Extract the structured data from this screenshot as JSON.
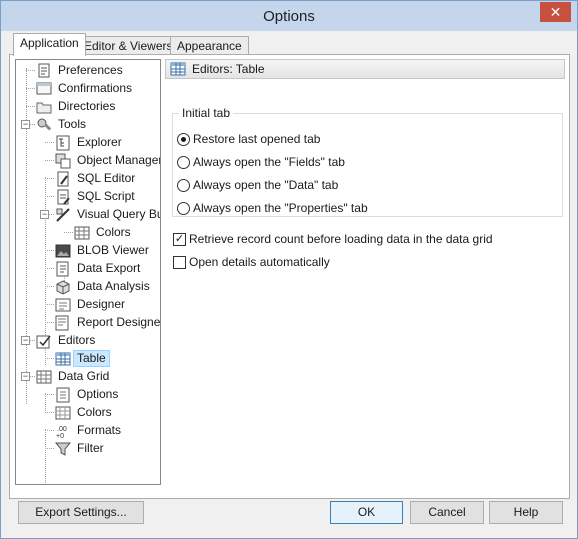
{
  "window": {
    "title": "Options",
    "close_glyph": "✕"
  },
  "tabs": [
    {
      "label": "Application",
      "active": true
    },
    {
      "label": "Editor & Viewers",
      "active": false
    },
    {
      "label": "Appearance",
      "active": false
    }
  ],
  "tree": {
    "items": [
      {
        "label": "Preferences",
        "icon": "preferences-icon",
        "level": 1
      },
      {
        "label": "Confirmations",
        "icon": "confirmations-icon",
        "level": 1
      },
      {
        "label": "Directories",
        "icon": "folder-icon",
        "level": 1
      },
      {
        "label": "Tools",
        "icon": "tools-icon",
        "level": 1,
        "expanded": true
      },
      {
        "label": "Explorer",
        "icon": "explorer-icon",
        "level": 2
      },
      {
        "label": "Object Manager",
        "icon": "object-manager-icon",
        "level": 2
      },
      {
        "label": "SQL Editor",
        "icon": "sql-editor-icon",
        "level": 2
      },
      {
        "label": "SQL Script",
        "icon": "sql-script-icon",
        "level": 2
      },
      {
        "label": "Visual Query Builder",
        "icon": "visual-query-icon",
        "level": 2,
        "expanded": true
      },
      {
        "label": "Colors",
        "icon": "grid-icon",
        "level": 3
      },
      {
        "label": "BLOB Viewer",
        "icon": "blob-viewer-icon",
        "level": 2
      },
      {
        "label": "Data Export",
        "icon": "data-export-icon",
        "level": 2
      },
      {
        "label": "Data Analysis",
        "icon": "data-analysis-icon",
        "level": 2
      },
      {
        "label": "Designer",
        "icon": "designer-icon",
        "level": 2
      },
      {
        "label": "Report Designer",
        "icon": "report-designer-icon",
        "level": 2
      },
      {
        "label": "Editors",
        "icon": "editors-icon",
        "level": 1,
        "expanded": true
      },
      {
        "label": "Table",
        "icon": "table-icon",
        "level": 2,
        "selected": true
      },
      {
        "label": "Data Grid",
        "icon": "grid-icon",
        "level": 1,
        "expanded": true
      },
      {
        "label": "Options",
        "icon": "options-icon",
        "level": 2
      },
      {
        "label": "Colors",
        "icon": "colors-icon",
        "level": 2
      },
      {
        "label": "Formats",
        "icon": "formats-icon",
        "level": 2
      },
      {
        "label": "Filter",
        "icon": "filter-icon",
        "level": 2
      }
    ]
  },
  "panel": {
    "header": "Editors: Table",
    "group_title": "Initial tab",
    "radios": [
      {
        "label": "Restore last opened tab",
        "checked": true
      },
      {
        "label": "Always open the \"Fields\" tab",
        "checked": false
      },
      {
        "label": "Always open the \"Data\" tab",
        "checked": false
      },
      {
        "label": "Always open the \"Properties\" tab",
        "checked": false
      }
    ],
    "checkboxes": [
      {
        "label": "Retrieve record count before loading data in the data grid",
        "checked": true
      },
      {
        "label": "Open details automatically",
        "checked": false
      }
    ]
  },
  "buttons": {
    "export": "Export Settings...",
    "ok": "OK",
    "cancel": "Cancel",
    "help": "Help"
  }
}
